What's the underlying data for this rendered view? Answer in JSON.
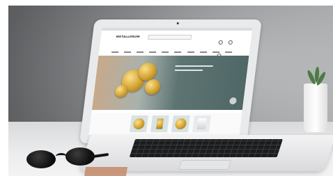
{
  "scene": {
    "description_tags": [
      "laptop",
      "gold-coins-website",
      "sunglasses",
      "plant",
      "desk"
    ]
  },
  "website": {
    "logo_text": "METALLORUM",
    "hero_headline": "",
    "hero_subtext": ""
  },
  "colors": {
    "hero_teal": "#4f6766",
    "gold": "#d2a232",
    "wall_gray": "#8b8d90"
  }
}
